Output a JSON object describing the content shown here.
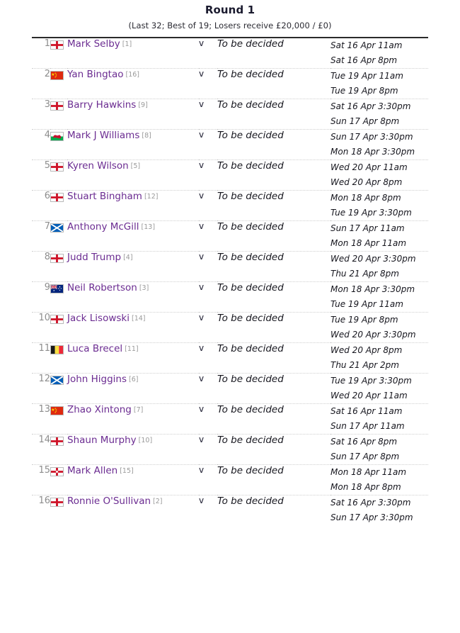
{
  "header": {
    "title": "Round 1",
    "subtitle": "(Last 32; Best of 19; Losers receive £20,000 / £0)"
  },
  "labels": {
    "versus": "v",
    "tbd": "To be decided"
  },
  "colors": {
    "player_link": "#6b2c91",
    "seed_grey": "#9a9a9a",
    "rule": "#2a2a2a",
    "row_divider": "#cfcfcf"
  },
  "matches": [
    {
      "num": "1",
      "flag": "england",
      "name": "Mark Selby",
      "seed": "[1]",
      "v": "v",
      "opponent": "To be decided",
      "date1": "Sat 16 Apr 11am",
      "date2": "Sat 16 Apr 8pm"
    },
    {
      "num": "2",
      "flag": "china",
      "name": "Yan Bingtao",
      "seed": "[16]",
      "v": "v",
      "opponent": "To be decided",
      "date1": "Tue 19 Apr 11am",
      "date2": "Tue 19 Apr 8pm"
    },
    {
      "num": "3",
      "flag": "england",
      "name": "Barry Hawkins",
      "seed": "[9]",
      "v": "v",
      "opponent": "To be decided",
      "date1": "Sat 16 Apr 3:30pm",
      "date2": "Sun 17 Apr 8pm"
    },
    {
      "num": "4",
      "flag": "wales",
      "name": "Mark J Williams",
      "seed": "[8]",
      "v": "v",
      "opponent": "To be decided",
      "date1": "Sun 17 Apr 3:30pm",
      "date2": "Mon 18 Apr 3:30pm"
    },
    {
      "num": "5",
      "flag": "england",
      "name": "Kyren Wilson",
      "seed": "[5]",
      "v": "v",
      "opponent": "To be decided",
      "date1": "Wed 20 Apr 11am",
      "date2": "Wed 20 Apr 8pm"
    },
    {
      "num": "6",
      "flag": "england",
      "name": "Stuart Bingham",
      "seed": "[12]",
      "v": "v",
      "opponent": "To be decided",
      "date1": "Mon 18 Apr 8pm",
      "date2": "Tue 19 Apr 3:30pm"
    },
    {
      "num": "7",
      "flag": "scotland",
      "name": "Anthony McGill",
      "seed": "[13]",
      "v": "v",
      "opponent": "To be decided",
      "date1": "Sun 17 Apr 11am",
      "date2": "Mon 18 Apr 11am"
    },
    {
      "num": "8",
      "flag": "england",
      "name": "Judd Trump",
      "seed": "[4]",
      "v": "v",
      "opponent": "To be decided",
      "date1": "Wed 20 Apr 3:30pm",
      "date2": "Thu 21 Apr 8pm"
    },
    {
      "num": "9",
      "flag": "australia",
      "name": "Neil Robertson",
      "seed": "[3]",
      "v": "v",
      "opponent": "To be decided",
      "date1": "Mon 18 Apr 3:30pm",
      "date2": "Tue 19 Apr 11am"
    },
    {
      "num": "10",
      "flag": "england",
      "name": "Jack Lisowski",
      "seed": "[14]",
      "v": "v",
      "opponent": "To be decided",
      "date1": "Tue 19 Apr 8pm",
      "date2": "Wed 20 Apr 3:30pm"
    },
    {
      "num": "11",
      "flag": "belgium",
      "name": "Luca Brecel",
      "seed": "[11]",
      "v": "v",
      "opponent": "To be decided",
      "date1": "Wed 20 Apr 8pm",
      "date2": "Thu 21 Apr 2pm"
    },
    {
      "num": "12",
      "flag": "scotland",
      "name": "John Higgins",
      "seed": "[6]",
      "v": "v",
      "opponent": "To be decided",
      "date1": "Tue 19 Apr 3:30pm",
      "date2": "Wed 20 Apr 11am"
    },
    {
      "num": "13",
      "flag": "china",
      "name": "Zhao Xintong",
      "seed": "[7]",
      "v": "v",
      "opponent": "To be decided",
      "date1": "Sat 16 Apr 11am",
      "date2": "Sun 17 Apr 11am"
    },
    {
      "num": "14",
      "flag": "england",
      "name": "Shaun Murphy",
      "seed": "[10]",
      "v": "v",
      "opponent": "To be decided",
      "date1": "Sat 16 Apr 8pm",
      "date2": "Sun 17 Apr 8pm"
    },
    {
      "num": "15",
      "flag": "northern-ireland",
      "name": "Mark Allen",
      "seed": "[15]",
      "v": "v",
      "opponent": "To be decided",
      "date1": "Mon 18 Apr 11am",
      "date2": "Mon 18 Apr 8pm"
    },
    {
      "num": "16",
      "flag": "england",
      "name": "Ronnie O'Sullivan",
      "seed": "[2]",
      "v": "v",
      "opponent": "To be decided",
      "date1": "Sat 16 Apr 3:30pm",
      "date2": "Sun 17 Apr 3:30pm"
    }
  ]
}
